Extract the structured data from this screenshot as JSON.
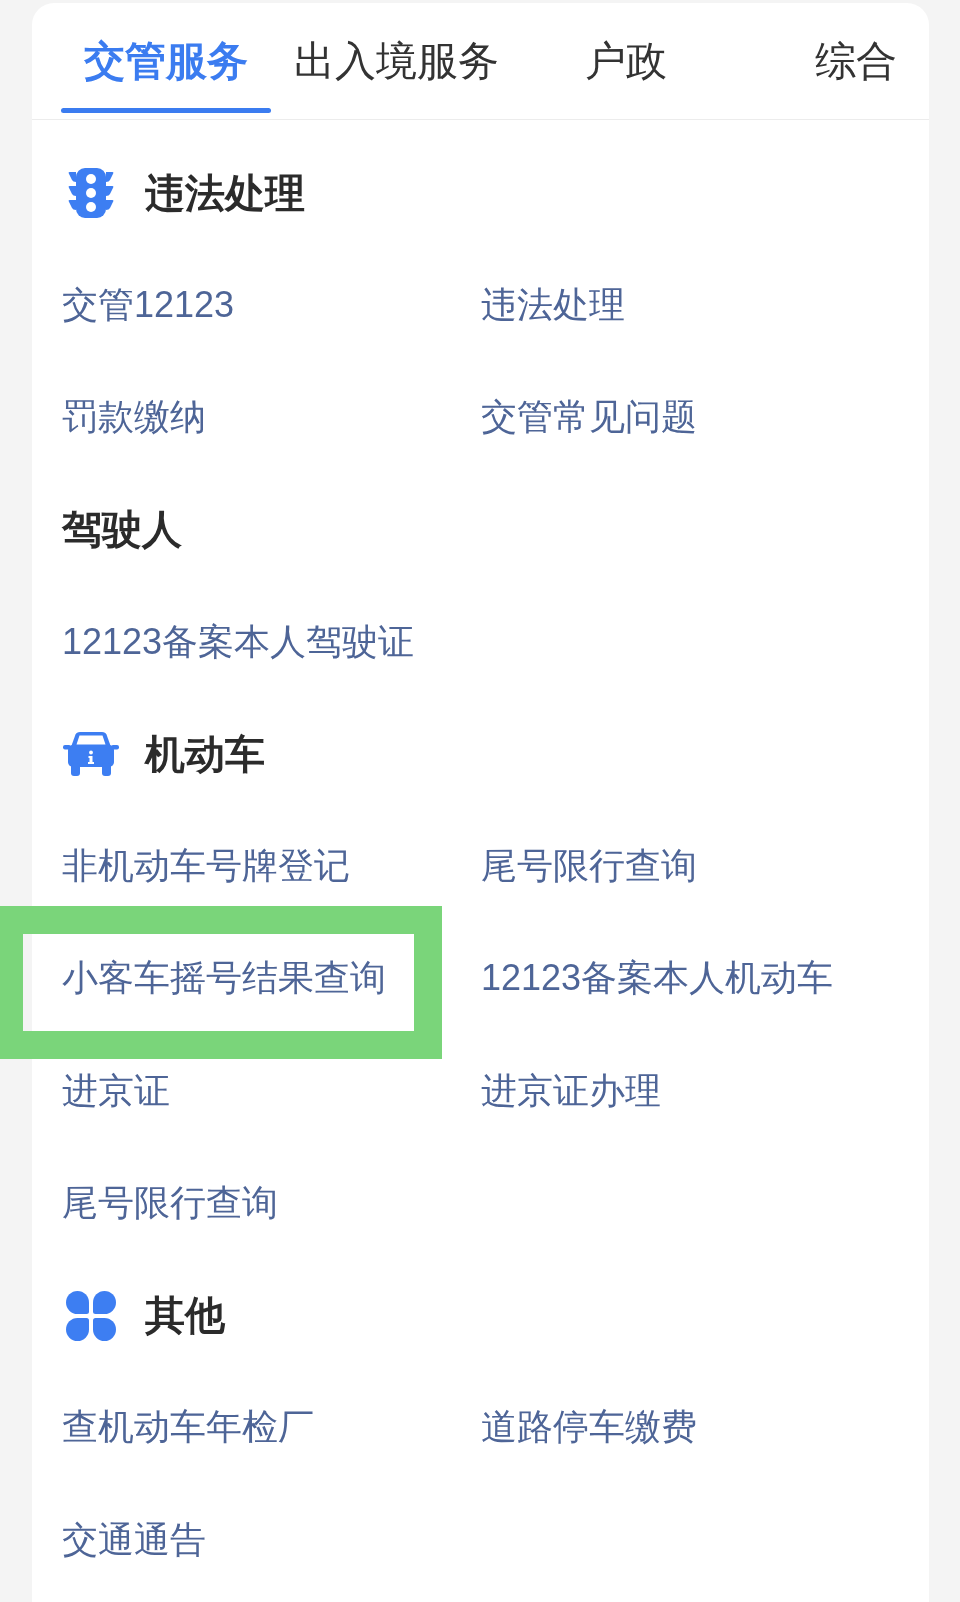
{
  "tabs": [
    {
      "label": "交管服务",
      "selected": true
    },
    {
      "label": "出入境服务",
      "selected": false
    },
    {
      "label": "户政",
      "selected": false
    },
    {
      "label": "综合",
      "selected": false
    }
  ],
  "sections": [
    {
      "kind": "violation",
      "title": "违法处理",
      "items": [
        {
          "label": "交管12123",
          "highlighted": false
        },
        {
          "label": "违法处理",
          "highlighted": false
        },
        {
          "label": "罚款缴纳",
          "highlighted": false
        },
        {
          "label": "交管常见问题",
          "highlighted": false
        }
      ]
    },
    {
      "kind": "driver",
      "title": "驾驶人",
      "items": [
        {
          "label": "12123备案本人驾驶证",
          "highlighted": false
        }
      ]
    },
    {
      "kind": "vehicle",
      "title": "机动车",
      "items": [
        {
          "label": "非机动车号牌登记",
          "highlighted": false
        },
        {
          "label": "尾号限行查询",
          "highlighted": false
        },
        {
          "label": "小客车摇号结果查询",
          "highlighted": true
        },
        {
          "label": "12123备案本人机动车",
          "highlighted": false
        },
        {
          "label": "进京证",
          "highlighted": false
        },
        {
          "label": "进京证办理",
          "highlighted": false
        },
        {
          "label": "尾号限行查询",
          "highlighted": false
        }
      ]
    },
    {
      "kind": "other",
      "title": "其他",
      "items": [
        {
          "label": "查机动车年检厂",
          "highlighted": false
        },
        {
          "label": "道路停车缴费",
          "highlighted": false
        },
        {
          "label": "交通通告",
          "highlighted": false
        }
      ]
    }
  ]
}
